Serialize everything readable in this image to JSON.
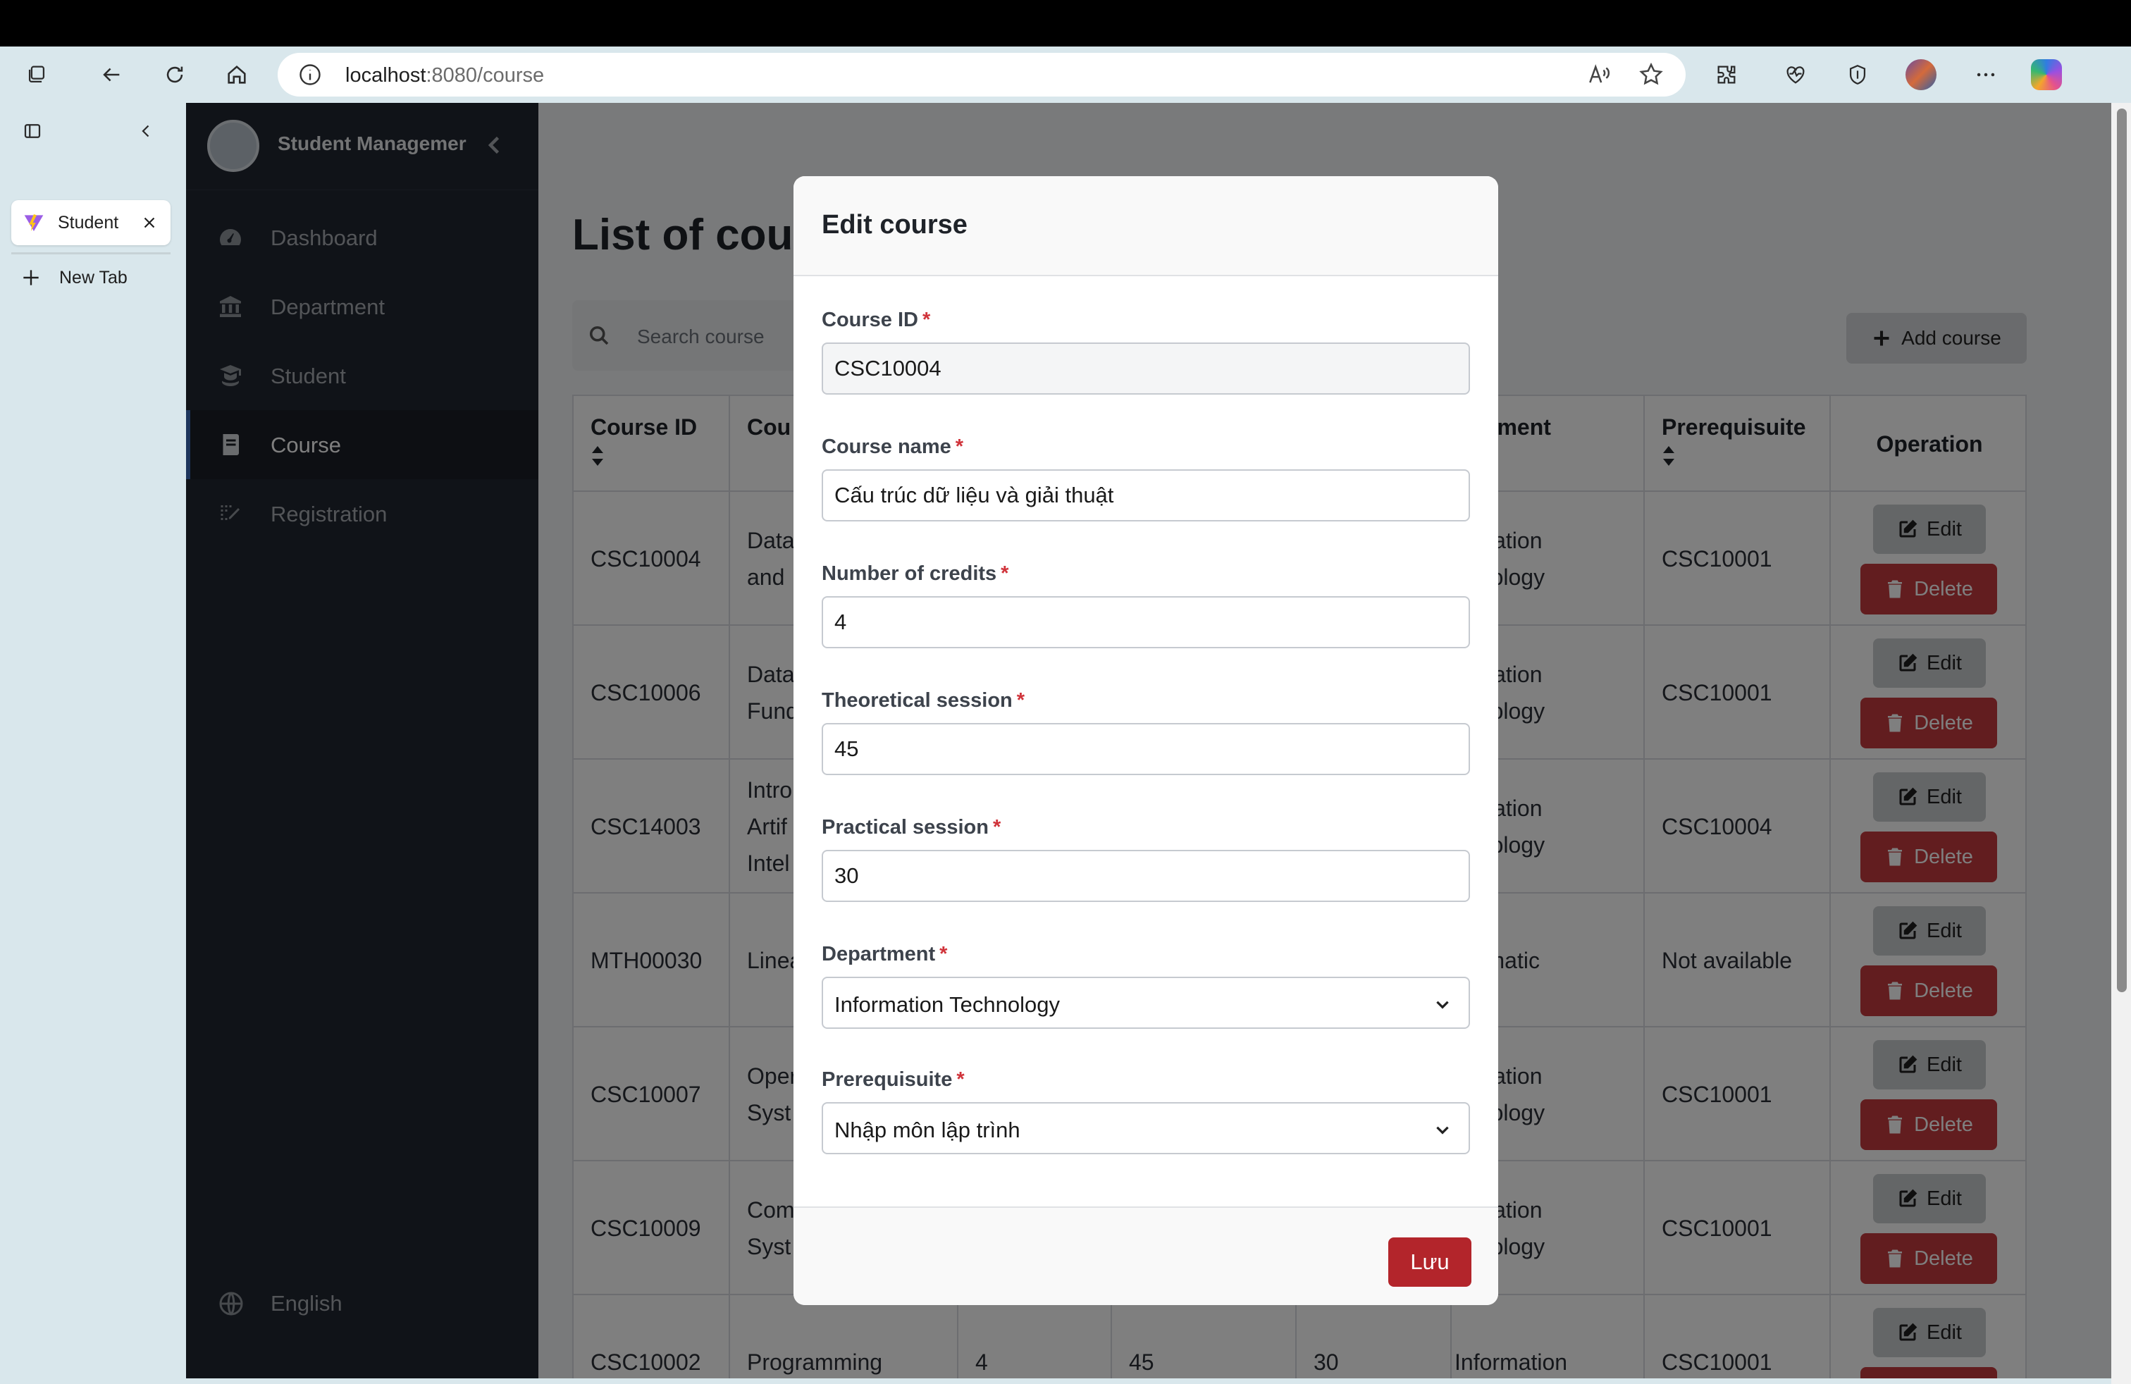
{
  "browser": {
    "url_host": "localhost",
    "url_path": ":8080/course",
    "tab_title": "Student",
    "new_tab_label": "New Tab"
  },
  "sidebar": {
    "brand": "Student Managemer",
    "items": [
      {
        "label": "Dashboard",
        "icon": "dashboard-icon"
      },
      {
        "label": "Department",
        "icon": "bank-icon"
      },
      {
        "label": "Student",
        "icon": "student-icon"
      },
      {
        "label": "Course",
        "icon": "book-icon",
        "active": true
      },
      {
        "label": "Registration",
        "icon": "registration-icon"
      }
    ],
    "language": "English"
  },
  "main": {
    "title": "List of cou",
    "search_placeholder": "Search course",
    "add_button": "Add course",
    "columns": [
      "Course ID",
      "Cou",
      "",
      "",
      "",
      "partment",
      "Prerequisuite",
      "Operation"
    ],
    "rows": [
      {
        "id": "CSC10004",
        "name": "Data\nand",
        "dept": "ormation\nchnology",
        "prereq": "CSC10001"
      },
      {
        "id": "CSC10006",
        "name": "Data\nFund",
        "dept": "ormation\nchnology",
        "prereq": "CSC10001"
      },
      {
        "id": "CSC14003",
        "name": "Intro\nArtif\nIntel",
        "dept": "ormation\nchnology",
        "prereq": "CSC10004"
      },
      {
        "id": "MTH00030",
        "name": "Linea",
        "dept": "thematic",
        "prereq": "Not available"
      },
      {
        "id": "CSC10007",
        "name": "Oper\nSyst",
        "dept": "ormation\nchnology",
        "prereq": "CSC10001"
      },
      {
        "id": "CSC10009",
        "name": "Com\nSyst",
        "dept": "ormation\nchnology",
        "prereq": "CSC10001"
      },
      {
        "id": "CSC10002",
        "name": "Programming",
        "credits": "4",
        "theory": "45",
        "practical": "30",
        "dept": "Information",
        "prereq": "CSC10001"
      }
    ],
    "edit_label": "Edit",
    "delete_label": "Delete"
  },
  "modal": {
    "title": "Edit course",
    "fields": {
      "course_id": {
        "label": "Course ID",
        "value": "CSC10004"
      },
      "course_name": {
        "label": "Course name",
        "value": "Cấu trúc dữ liệu và giải thuật"
      },
      "credits": {
        "label": "Number of credits",
        "value": "4"
      },
      "theory": {
        "label": "Theoretical session",
        "value": "45"
      },
      "practical": {
        "label": "Practical session",
        "value": "30"
      },
      "department": {
        "label": "Department",
        "value": "Information Technology"
      },
      "prerequisite": {
        "label": "Prerequisuite",
        "value": "Nhập môn lập trình"
      }
    },
    "required_mark": "*",
    "save_label": "Lưu"
  },
  "colors": {
    "sidebar_bg": "#212631",
    "delete_red": "#c53a3f",
    "save_red": "#b3252b",
    "required_red": "#d0333a"
  }
}
